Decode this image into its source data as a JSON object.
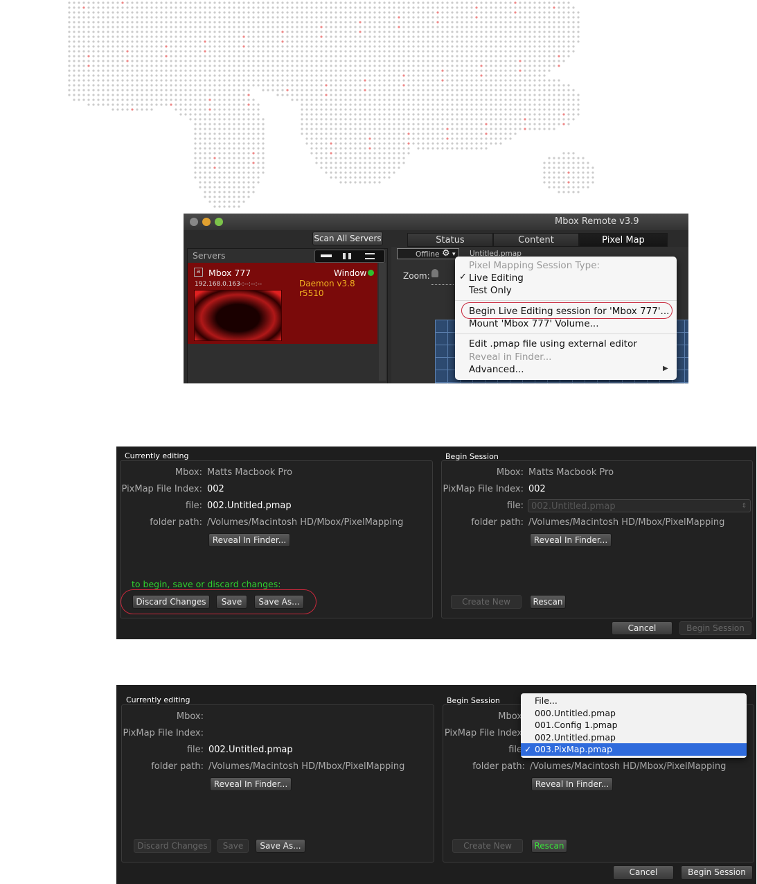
{
  "window": {
    "title": "Mbox Remote v3.9"
  },
  "toolbar": {
    "scan_all": "Scan All Servers"
  },
  "tabs": [
    "Status",
    "Content",
    "Pixel Map"
  ],
  "servers": {
    "header": "Servers",
    "item": {
      "name": "Mbox 777",
      "ip": "192.168.0.163",
      "time": "--:--:--:--",
      "mode": "Window",
      "daemon": "Daemon v3.8 r5510"
    }
  },
  "pixelmap": {
    "offline": "Offline",
    "filename": "Untitled.pmap",
    "zoom": "Zoom:"
  },
  "context_menu": {
    "items": [
      "Pixel Mapping Session Type:",
      "Live Editing",
      "Test Only",
      "Begin Live Editing session for 'Mbox 777'...",
      "Mount 'Mbox 777' Volume...",
      "Edit .pmap file using external editor",
      "Reveal in Finder...",
      "Advanced..."
    ],
    "checked": "Live Editing"
  },
  "dialog1": {
    "left": {
      "title": "Currently editing",
      "mbox_label": "Mbox:",
      "mbox": "Matts Macbook Pro",
      "index_label": "PixMap File Index:",
      "index": "002",
      "file_label": "file:",
      "file": "002.Untitled.pmap",
      "folder_label": "folder path:",
      "folder": "/Volumes/Macintosh HD/Mbox/PixelMapping",
      "reveal": "Reveal In Finder...",
      "hint": "to begin, save or discard changes:",
      "discard": "Discard Changes",
      "save": "Save",
      "save_as": "Save As..."
    },
    "right": {
      "title": "Begin Session",
      "mbox_label": "Mbox:",
      "mbox": "Matts Macbook Pro",
      "index_label": "PixMap File Index:",
      "index": "002",
      "file_label": "file:",
      "file": "002.Untitled.pmap",
      "folder_label": "folder path:",
      "folder": "/Volumes/Macintosh HD/Mbox/PixelMapping",
      "reveal": "Reveal In Finder...",
      "create_new": "Create New",
      "rescan": "Rescan"
    },
    "cancel": "Cancel",
    "begin": "Begin Session"
  },
  "dialog2": {
    "left": {
      "title": "Currently editing",
      "mbox_label": "Mbox:",
      "index_label": "PixMap File Index:",
      "file_label": "file:",
      "file": "002.Untitled.pmap",
      "folder_label": "folder path:",
      "folder": "/Volumes/Macintosh HD/Mbox/PixelMapping",
      "reveal": "Reveal In Finder...",
      "discard": "Discard Changes",
      "save": "Save",
      "save_as": "Save As..."
    },
    "right": {
      "title": "Begin Session",
      "mbox_label": "Mbox",
      "index_label": "PixMap File Index",
      "file_label": "file",
      "folder_label": "folder path:",
      "folder": "/Volumes/Macintosh HD/Mbox/PixelMapping",
      "reveal": "Reveal In Finder...",
      "create_new": "Create New",
      "rescan": "Rescan"
    },
    "file_popup": [
      "File...",
      "000.Untitled.pmap",
      "001.Config 1.pmap",
      "002.Untitled.pmap",
      "003.PixMap.pmap"
    ],
    "popup_selected": "003.PixMap.pmap",
    "cancel": "Cancel",
    "begin": "Begin Session"
  },
  "colors": {
    "accent_red": "#c8283c",
    "hint_green": "#2fd12f",
    "selection_blue": "#2f6bdc",
    "server_bg": "#7a0a0a"
  }
}
